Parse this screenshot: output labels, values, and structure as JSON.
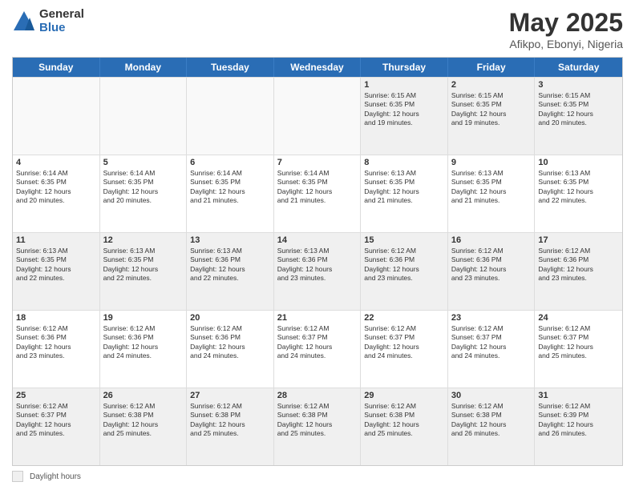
{
  "logo": {
    "general": "General",
    "blue": "Blue"
  },
  "title": "May 2025",
  "subtitle": "Afikpo, Ebonyi, Nigeria",
  "days_of_week": [
    "Sunday",
    "Monday",
    "Tuesday",
    "Wednesday",
    "Thursday",
    "Friday",
    "Saturday"
  ],
  "footer": {
    "legend_label": "Daylight hours"
  },
  "weeks": [
    [
      {
        "day": "",
        "info": ""
      },
      {
        "day": "",
        "info": ""
      },
      {
        "day": "",
        "info": ""
      },
      {
        "day": "",
        "info": ""
      },
      {
        "day": "1",
        "info": "Sunrise: 6:15 AM\nSunset: 6:35 PM\nDaylight: 12 hours\nand 19 minutes."
      },
      {
        "day": "2",
        "info": "Sunrise: 6:15 AM\nSunset: 6:35 PM\nDaylight: 12 hours\nand 19 minutes."
      },
      {
        "day": "3",
        "info": "Sunrise: 6:15 AM\nSunset: 6:35 PM\nDaylight: 12 hours\nand 20 minutes."
      }
    ],
    [
      {
        "day": "4",
        "info": "Sunrise: 6:14 AM\nSunset: 6:35 PM\nDaylight: 12 hours\nand 20 minutes."
      },
      {
        "day": "5",
        "info": "Sunrise: 6:14 AM\nSunset: 6:35 PM\nDaylight: 12 hours\nand 20 minutes."
      },
      {
        "day": "6",
        "info": "Sunrise: 6:14 AM\nSunset: 6:35 PM\nDaylight: 12 hours\nand 21 minutes."
      },
      {
        "day": "7",
        "info": "Sunrise: 6:14 AM\nSunset: 6:35 PM\nDaylight: 12 hours\nand 21 minutes."
      },
      {
        "day": "8",
        "info": "Sunrise: 6:13 AM\nSunset: 6:35 PM\nDaylight: 12 hours\nand 21 minutes."
      },
      {
        "day": "9",
        "info": "Sunrise: 6:13 AM\nSunset: 6:35 PM\nDaylight: 12 hours\nand 21 minutes."
      },
      {
        "day": "10",
        "info": "Sunrise: 6:13 AM\nSunset: 6:35 PM\nDaylight: 12 hours\nand 22 minutes."
      }
    ],
    [
      {
        "day": "11",
        "info": "Sunrise: 6:13 AM\nSunset: 6:35 PM\nDaylight: 12 hours\nand 22 minutes."
      },
      {
        "day": "12",
        "info": "Sunrise: 6:13 AM\nSunset: 6:35 PM\nDaylight: 12 hours\nand 22 minutes."
      },
      {
        "day": "13",
        "info": "Sunrise: 6:13 AM\nSunset: 6:36 PM\nDaylight: 12 hours\nand 22 minutes."
      },
      {
        "day": "14",
        "info": "Sunrise: 6:13 AM\nSunset: 6:36 PM\nDaylight: 12 hours\nand 23 minutes."
      },
      {
        "day": "15",
        "info": "Sunrise: 6:12 AM\nSunset: 6:36 PM\nDaylight: 12 hours\nand 23 minutes."
      },
      {
        "day": "16",
        "info": "Sunrise: 6:12 AM\nSunset: 6:36 PM\nDaylight: 12 hours\nand 23 minutes."
      },
      {
        "day": "17",
        "info": "Sunrise: 6:12 AM\nSunset: 6:36 PM\nDaylight: 12 hours\nand 23 minutes."
      }
    ],
    [
      {
        "day": "18",
        "info": "Sunrise: 6:12 AM\nSunset: 6:36 PM\nDaylight: 12 hours\nand 23 minutes."
      },
      {
        "day": "19",
        "info": "Sunrise: 6:12 AM\nSunset: 6:36 PM\nDaylight: 12 hours\nand 24 minutes."
      },
      {
        "day": "20",
        "info": "Sunrise: 6:12 AM\nSunset: 6:36 PM\nDaylight: 12 hours\nand 24 minutes."
      },
      {
        "day": "21",
        "info": "Sunrise: 6:12 AM\nSunset: 6:37 PM\nDaylight: 12 hours\nand 24 minutes."
      },
      {
        "day": "22",
        "info": "Sunrise: 6:12 AM\nSunset: 6:37 PM\nDaylight: 12 hours\nand 24 minutes."
      },
      {
        "day": "23",
        "info": "Sunrise: 6:12 AM\nSunset: 6:37 PM\nDaylight: 12 hours\nand 24 minutes."
      },
      {
        "day": "24",
        "info": "Sunrise: 6:12 AM\nSunset: 6:37 PM\nDaylight: 12 hours\nand 25 minutes."
      }
    ],
    [
      {
        "day": "25",
        "info": "Sunrise: 6:12 AM\nSunset: 6:37 PM\nDaylight: 12 hours\nand 25 minutes."
      },
      {
        "day": "26",
        "info": "Sunrise: 6:12 AM\nSunset: 6:38 PM\nDaylight: 12 hours\nand 25 minutes."
      },
      {
        "day": "27",
        "info": "Sunrise: 6:12 AM\nSunset: 6:38 PM\nDaylight: 12 hours\nand 25 minutes."
      },
      {
        "day": "28",
        "info": "Sunrise: 6:12 AM\nSunset: 6:38 PM\nDaylight: 12 hours\nand 25 minutes."
      },
      {
        "day": "29",
        "info": "Sunrise: 6:12 AM\nSunset: 6:38 PM\nDaylight: 12 hours\nand 25 minutes."
      },
      {
        "day": "30",
        "info": "Sunrise: 6:12 AM\nSunset: 6:38 PM\nDaylight: 12 hours\nand 26 minutes."
      },
      {
        "day": "31",
        "info": "Sunrise: 6:12 AM\nSunset: 6:39 PM\nDaylight: 12 hours\nand 26 minutes."
      }
    ]
  ]
}
